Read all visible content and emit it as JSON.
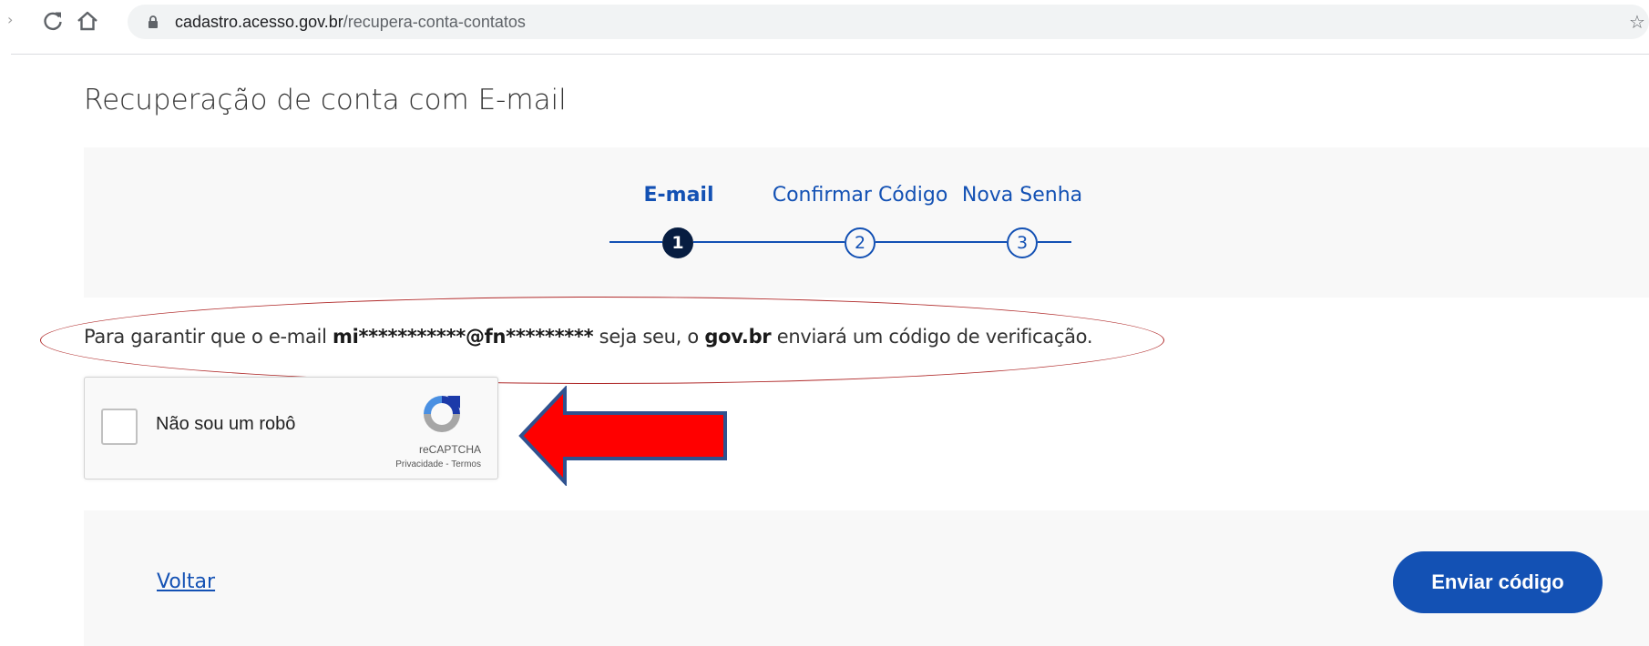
{
  "browser": {
    "url_host": "cadastro.acesso.gov.br",
    "url_path": "/recupera-conta-contatos"
  },
  "page": {
    "title": "Recuperação de conta com E-mail"
  },
  "steps": [
    {
      "label": "E-mail",
      "number": "1",
      "active": true
    },
    {
      "label": "Confirmar Código",
      "number": "2",
      "active": false
    },
    {
      "label": "Nova Senha",
      "number": "3",
      "active": false
    }
  ],
  "info": {
    "prefix": "Para garantir que o e-mail ",
    "masked_email_user": "mi***********",
    "masked_email_domain": "@fn*********",
    "middle": " seja seu, o ",
    "brand": "gov.br",
    "suffix": " enviará um código de verificação."
  },
  "captcha": {
    "label": "Não sou um robô",
    "brand": "reCAPTCHA",
    "privacy": "Privacidade",
    "separator": " - ",
    "terms": "Termos"
  },
  "actions": {
    "back_label": "Voltar",
    "submit_label": "Enviar código"
  },
  "colors": {
    "primary": "#1351b4",
    "step_active": "#071d41",
    "annotation_red": "#ff0000",
    "annotation_outline": "#2f528f"
  }
}
